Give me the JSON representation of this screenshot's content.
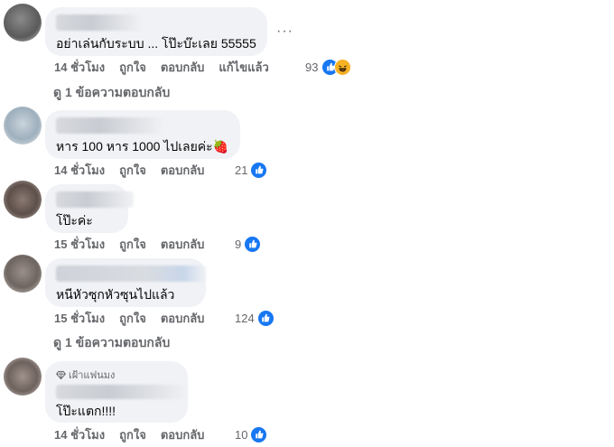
{
  "comments": [
    {
      "text": "อย่าเล่นกับระบบ ... โป๊ะบ๊ะเลย 55555",
      "time": "14 ชั่วโมง",
      "like": "ถูกใจ",
      "reply": "ตอบกลับ",
      "edited": "แก้ไขแล้ว",
      "reactions": "93",
      "replies": "ดู 1 ข้อความตอบกลับ",
      "more": "···"
    },
    {
      "text": "หาร 100 หาร 1000 ไปเลยค่ะ🍓",
      "time": "14 ชั่วโมง",
      "like": "ถูกใจ",
      "reply": "ตอบกลับ",
      "reactions": "21"
    },
    {
      "text": "โป๊ะค่ะ",
      "time": "15 ชั่วโมง",
      "like": "ถูกใจ",
      "reply": "ตอบกลับ",
      "reactions": "9"
    },
    {
      "text": "หนีหัวซุกหัวซุนไปแล้ว",
      "time": "15 ชั่วโมง",
      "like": "ถูกใจ",
      "reply": "ตอบกลับ",
      "reactions": "124",
      "replies": "ดู 1 ข้อความตอบกลับ"
    },
    {
      "badge": "เฝ้าแฟนมง",
      "text": "โป๊ะแตก!!!!",
      "time": "14 ชั่วโมง",
      "like": "ถูกใจ",
      "reply": "ตอบกลับ",
      "reactions": "10"
    }
  ],
  "colors": {
    "bubble": "#f0f2f5",
    "like": "#1877f2",
    "meta": "#65676b"
  }
}
